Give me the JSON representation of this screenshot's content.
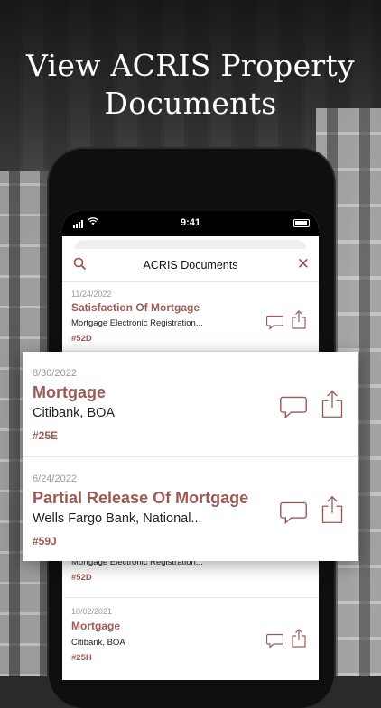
{
  "headline": {
    "line1": "View ACRIS Property",
    "line2": "Documents"
  },
  "status_bar": {
    "time": "9:41"
  },
  "nav": {
    "title": "ACRIS Documents"
  },
  "documents": [
    {
      "date": "11/24/2022",
      "title": "Satisfaction Of Mortgage",
      "party": "Mortgage Electronic Registration...",
      "unit": "#52D"
    },
    {
      "date": "8/30/2022",
      "title": "Mortgage",
      "party": "Citibank, BOA",
      "unit": "#25E"
    },
    {
      "date": "6/24/2022",
      "title": "Partial Release Of Mortgage",
      "party": "Wells Fargo Bank, National...",
      "unit": "#59J"
    },
    {
      "party": "Mortgage Electronic Registration...",
      "unit": "#52D"
    },
    {
      "date": "10/02/2021",
      "title": "Mortgage",
      "party": "Citibank, BOA",
      "unit": "#25H"
    }
  ],
  "icons": {
    "comment": "comment-icon",
    "share": "share-icon",
    "search": "search-icon",
    "close": "close-icon"
  },
  "colors": {
    "accent": "#9c5a56",
    "date": "#9a9a9a"
  }
}
